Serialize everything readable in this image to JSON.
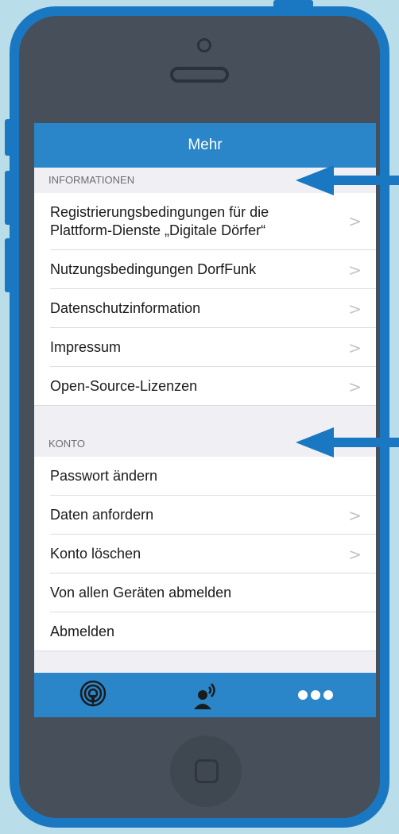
{
  "navbar": {
    "title": "Mehr"
  },
  "sections": [
    {
      "header": "INFORMATIONEN",
      "items": [
        {
          "label_line1": "Registrierungsbedingungen für die",
          "label_line2": "Plattform-Dienste „Digitale Dörfer“",
          "chevron": true
        },
        {
          "label": "Nutzungsbedingungen DorfFunk",
          "chevron": true
        },
        {
          "label": "Datenschutzinformation",
          "chevron": true
        },
        {
          "label": "Impressum",
          "chevron": true
        },
        {
          "label": "Open-Source-Lizenzen",
          "chevron": true
        }
      ]
    },
    {
      "header": "KONTO",
      "items": [
        {
          "label": "Passwort ändern",
          "chevron": false
        },
        {
          "label": "Daten anfordern",
          "chevron": true
        },
        {
          "label": "Konto löschen",
          "chevron": true
        },
        {
          "label": "Von allen Geräten abmelden",
          "chevron": false
        },
        {
          "label": "Abmelden",
          "chevron": false
        }
      ]
    }
  ],
  "chevron_glyph": ">",
  "tabbar": {
    "tabs": [
      {
        "icon": "broadcast-icon"
      },
      {
        "icon": "person-speaking-icon"
      },
      {
        "icon": "more-dots-icon"
      }
    ]
  },
  "colors": {
    "brand_blue": "#2a86c9",
    "phone_frame": "#1a78c2",
    "background": "#b9dde9",
    "arrow": "#1a78c2"
  }
}
